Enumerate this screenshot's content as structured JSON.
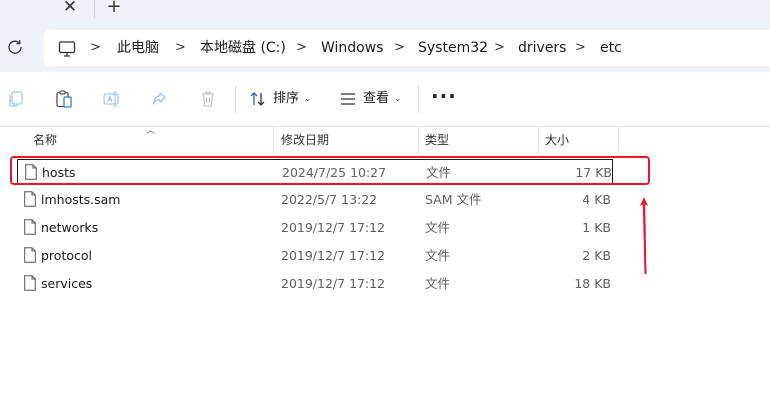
{
  "tabstrip": {
    "close_glyph": "✕",
    "new_tab_glyph": "+"
  },
  "address": {
    "crumbs": [
      "此电脑",
      "本地磁盘 (C:)",
      "Windows",
      "System32",
      "drivers",
      "etc"
    ],
    "separator": ">"
  },
  "toolbar": {
    "sort_label": "排序",
    "view_label": "查看",
    "more_glyph": "···"
  },
  "columns": {
    "name": "名称",
    "modified": "修改日期",
    "type": "类型",
    "size": "大小"
  },
  "files": [
    {
      "name": "hosts",
      "modified": "2024/7/25 10:27",
      "type": "文件",
      "size": "17 KB",
      "selected": true
    },
    {
      "name": "lmhosts.sam",
      "modified": "2022/5/7 13:22",
      "type": "SAM 文件",
      "size": "4 KB",
      "selected": false
    },
    {
      "name": "networks",
      "modified": "2019/12/7 17:12",
      "type": "文件",
      "size": "1 KB",
      "selected": false
    },
    {
      "name": "protocol",
      "modified": "2019/12/7 17:12",
      "type": "文件",
      "size": "2 KB",
      "selected": false
    },
    {
      "name": "services",
      "modified": "2019/12/7 17:12",
      "type": "文件",
      "size": "18 KB",
      "selected": false
    }
  ],
  "colors": {
    "annotation": "#e8192c",
    "chrome_bg": "#eef3f9"
  }
}
